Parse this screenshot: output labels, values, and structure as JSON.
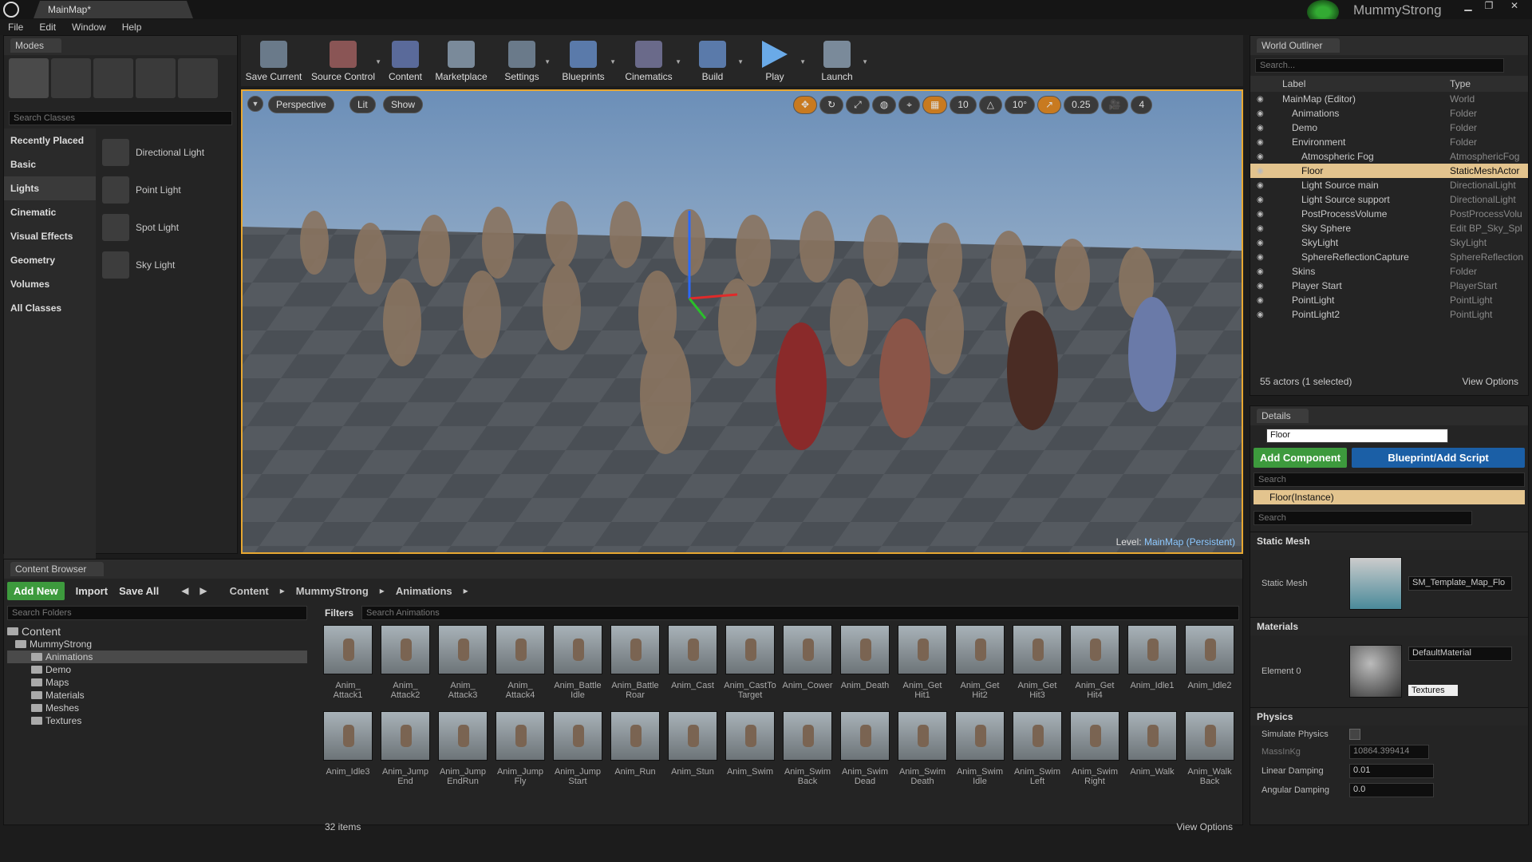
{
  "app": {
    "tab_title": "MainMap*",
    "project": "MummyStrong",
    "menu": [
      "File",
      "Edit",
      "Window",
      "Help"
    ]
  },
  "colors": {
    "accent": "#e8a832",
    "blue": "#1b5fa6",
    "green": "#3d9a3d",
    "selection": "#e3c48e"
  },
  "modes": {
    "title": "Modes",
    "search_placeholder": "Search Classes",
    "categories": [
      "Recently Placed",
      "Basic",
      "Lights",
      "Cinematic",
      "Visual Effects",
      "Geometry",
      "Volumes",
      "All Classes"
    ],
    "active": "Lights",
    "items": [
      {
        "label": "Directional Light",
        "icon": "directional-light-icon"
      },
      {
        "label": "Point Light",
        "icon": "point-light-icon"
      },
      {
        "label": "Spot Light",
        "icon": "spot-light-icon"
      },
      {
        "label": "Sky Light",
        "icon": "sky-light-icon"
      }
    ]
  },
  "toolbar": [
    {
      "label": "Save Current",
      "icon": "save-icon"
    },
    {
      "label": "Source Control",
      "icon": "source-control-icon"
    },
    {
      "label": "Content",
      "icon": "content-icon"
    },
    {
      "label": "Marketplace",
      "icon": "marketplace-icon"
    },
    {
      "label": "Settings",
      "icon": "settings-icon"
    },
    {
      "label": "Blueprints",
      "icon": "blueprints-icon"
    },
    {
      "label": "Cinematics",
      "icon": "cinematics-icon"
    },
    {
      "label": "Build",
      "icon": "build-icon"
    },
    {
      "label": "Play",
      "icon": "play-icon"
    },
    {
      "label": "Launch",
      "icon": "launch-icon"
    }
  ],
  "viewport": {
    "perspective": "Perspective",
    "lit": "Lit",
    "show": "Show",
    "grid_snap": "10",
    "rot_snap": "10°",
    "scale_snap": "0.25",
    "cam_speed": "4",
    "level_label": "Level:",
    "level_name": "MainMap (Persistent)"
  },
  "outliner": {
    "title": "World Outliner",
    "search_placeholder": "Search...",
    "col_label": "Label",
    "col_type": "Type",
    "rows": [
      {
        "label": "MainMap (Editor)",
        "type": "World",
        "indent": 0
      },
      {
        "label": "Animations",
        "type": "Folder",
        "indent": 1
      },
      {
        "label": "Demo",
        "type": "Folder",
        "indent": 1
      },
      {
        "label": "Environment",
        "type": "Folder",
        "indent": 1
      },
      {
        "label": "Atmospheric Fog",
        "type": "AtmosphericFog",
        "indent": 2
      },
      {
        "label": "Floor",
        "type": "StaticMeshActor",
        "indent": 2
      },
      {
        "label": "Light Source main",
        "type": "DirectionalLight",
        "indent": 2
      },
      {
        "label": "Light Source support",
        "type": "DirectionalLight",
        "indent": 2
      },
      {
        "label": "PostProcessVolume",
        "type": "PostProcessVolu",
        "indent": 2
      },
      {
        "label": "Sky Sphere",
        "type": "Edit BP_Sky_Spl",
        "indent": 2
      },
      {
        "label": "SkyLight",
        "type": "SkyLight",
        "indent": 2
      },
      {
        "label": "SphereReflectionCapture",
        "type": "SphereReflection",
        "indent": 2
      },
      {
        "label": "Skins",
        "type": "Folder",
        "indent": 1
      },
      {
        "label": "Player Start",
        "type": "PlayerStart",
        "indent": 1
      },
      {
        "label": "PointLight",
        "type": "PointLight",
        "indent": 1
      },
      {
        "label": "PointLight2",
        "type": "PointLight",
        "indent": 1
      }
    ],
    "selected": "Floor",
    "status": "55 actors (1 selected)",
    "view_options": "View Options"
  },
  "details": {
    "title": "Details",
    "name": "Floor",
    "add_component": "Add Component",
    "blueprint": "Blueprint/Add Script",
    "search_placeholder": "Search",
    "instance": "Floor(Instance)",
    "static_mesh_section": "Static Mesh",
    "static_mesh_label": "Static Mesh",
    "static_mesh_value": "SM_Template_Map_Flo",
    "materials_section": "Materials",
    "element0": "Element 0",
    "material_value": "DefaultMaterial",
    "textures": "Textures",
    "physics_section": "Physics",
    "simulate_physics": "Simulate Physics",
    "mass_label": "MassInKg",
    "mass_value": "10864.399414",
    "linear_damping_label": "Linear Damping",
    "linear_damping_value": "0.01",
    "angular_damping_label": "Angular Damping",
    "angular_damping_value": "0.0"
  },
  "content_browser": {
    "title": "Content Browser",
    "add_new": "Add New",
    "import": "Import",
    "save_all": "Save All",
    "path": [
      "Content",
      "MummyStrong",
      "Animations"
    ],
    "search_folders": "Search Folders",
    "filters": "Filters",
    "search_assets": "Search Animations",
    "folders": {
      "root": "Content",
      "project": "MummyStrong",
      "children": [
        "Animations",
        "Demo",
        "Maps",
        "Materials",
        "Meshes",
        "Textures"
      ]
    },
    "assets": [
      "Anim_\nAttack1",
      "Anim_\nAttack2",
      "Anim_\nAttack3",
      "Anim_\nAttack4",
      "Anim_Battle\nIdle",
      "Anim_Battle\nRoar",
      "Anim_Cast",
      "Anim_CastTo\nTarget",
      "Anim_Cower",
      "Anim_Death",
      "Anim_Get\nHit1",
      "Anim_Get\nHit2",
      "Anim_Get\nHit3",
      "Anim_Get\nHit4",
      "Anim_Idle1",
      "Anim_Idle2",
      "Anim_Idle3",
      "Anim_Jump\nEnd",
      "Anim_Jump\nEndRun",
      "Anim_Jump\nFly",
      "Anim_Jump\nStart",
      "Anim_Run",
      "Anim_Stun",
      "Anim_Swim",
      "Anim_Swim\nBack",
      "Anim_Swim\nDead",
      "Anim_Swim\nDeath",
      "Anim_Swim\nIdle",
      "Anim_Swim\nLeft",
      "Anim_Swim\nRight",
      "Anim_Walk",
      "Anim_Walk\nBack"
    ],
    "count": "32 items",
    "view_options": "View Options"
  }
}
